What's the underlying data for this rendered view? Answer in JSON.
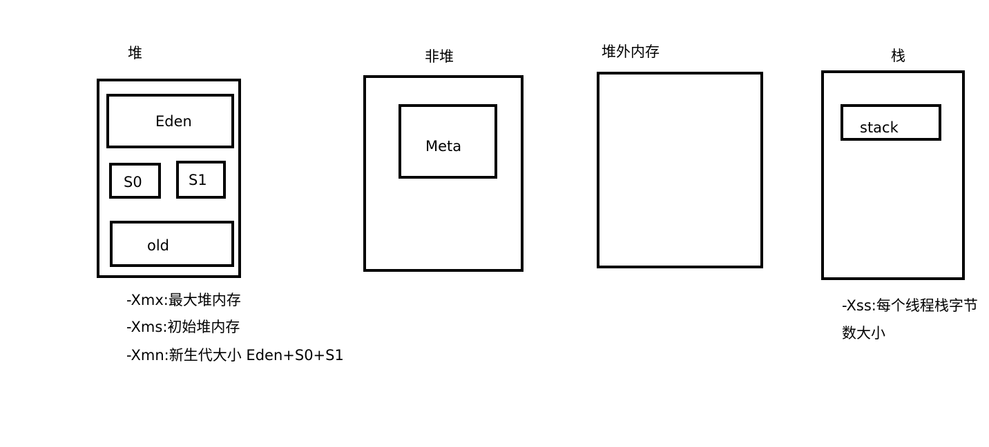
{
  "heap": {
    "title": "堆",
    "eden": "Eden",
    "s0": "S0",
    "s1": "S1",
    "old": "old",
    "notes": [
      "-Xmx:最大堆内存",
      "-Xms:初始堆内存",
      "-Xmn:新生代大小 Eden+S0+S1"
    ]
  },
  "nonheap": {
    "title": "非堆",
    "meta": "Meta"
  },
  "offheap": {
    "title": "堆外内存"
  },
  "stack": {
    "title": "栈",
    "stack": "stack",
    "notes": [
      "-Xss:每个线程栈字节",
      "数大小"
    ]
  }
}
